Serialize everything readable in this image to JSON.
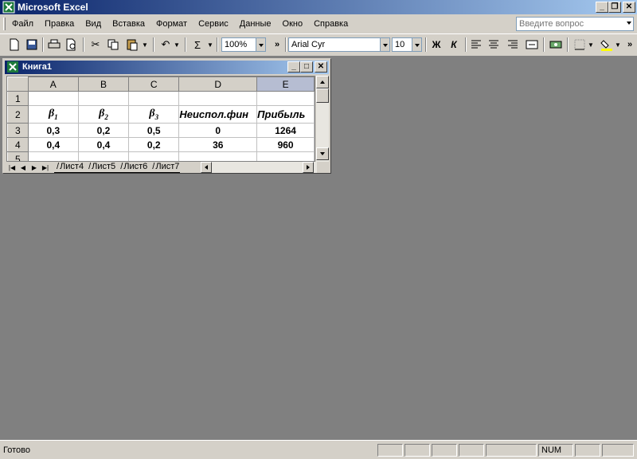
{
  "app": {
    "title": "Microsoft Excel"
  },
  "menu": {
    "items": [
      "Файл",
      "Правка",
      "Вид",
      "Вставка",
      "Формат",
      "Сервис",
      "Данные",
      "Окно",
      "Справка"
    ],
    "help_placeholder": "Введите вопрос"
  },
  "toolbar": {
    "zoom": "100%",
    "font": "Arial Cyr",
    "font_size": "10",
    "bold": "Ж",
    "italic": "К",
    "sum": "Σ"
  },
  "workbook": {
    "title": "Книга1",
    "columns": [
      "A",
      "B",
      "C",
      "D",
      "E"
    ],
    "rows": [
      {
        "num": "1",
        "cells": [
          "",
          "",
          "",
          "",
          ""
        ]
      },
      {
        "num": "2",
        "cells": [
          "β1",
          "β2",
          "β3",
          "Неиспол.фин",
          "Прибыль"
        ]
      },
      {
        "num": "3",
        "cells": [
          "0,3",
          "0,2",
          "0,5",
          "0",
          "1264"
        ]
      },
      {
        "num": "4",
        "cells": [
          "0,4",
          "0,4",
          "0,2",
          "36",
          "960"
        ]
      },
      {
        "num": "5",
        "cells": [
          "",
          "",
          "",
          "",
          ""
        ]
      }
    ],
    "betas": [
      {
        "letter": "β",
        "sub": "1"
      },
      {
        "letter": "β",
        "sub": "2"
      },
      {
        "letter": "β",
        "sub": "3"
      }
    ],
    "sheet_tabs": [
      "Лист4",
      "Лист5",
      "Лист6",
      "Лист7"
    ]
  },
  "status": {
    "ready": "Готово",
    "num": "NUM"
  },
  "colors": {
    "title_start": "#0a246a",
    "title_end": "#a6caf0",
    "workspace": "#808080",
    "face": "#d4d0c8"
  }
}
